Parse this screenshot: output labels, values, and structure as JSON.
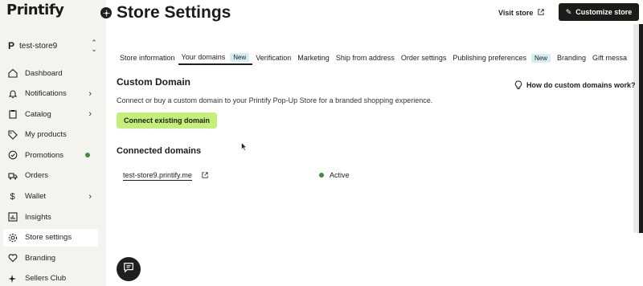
{
  "brand": {
    "logo_text": "Printify"
  },
  "store_switcher": {
    "store_name": "test-store9"
  },
  "sidebar": {
    "items": [
      {
        "label": "Dashboard",
        "icon": "home-icon"
      },
      {
        "label": "Notifications",
        "icon": "bell-icon",
        "has_arrow": true
      },
      {
        "label": "Catalog",
        "icon": "clipboard-icon",
        "has_arrow": true
      },
      {
        "label": "My products",
        "icon": "tag-icon"
      },
      {
        "label": "Promotions",
        "icon": "badge-check-icon",
        "has_dot": true
      },
      {
        "label": "Orders",
        "icon": "truck-icon"
      },
      {
        "label": "Wallet",
        "icon": "dollar-icon",
        "has_arrow": true
      },
      {
        "label": "Insights",
        "icon": "chart-icon"
      },
      {
        "label": "Store settings",
        "icon": "gear-icon",
        "active": true
      },
      {
        "label": "Branding",
        "icon": "heart-icon"
      },
      {
        "label": "Sellers Club",
        "icon": "sparkle-icon"
      }
    ]
  },
  "header": {
    "title": "Store Settings",
    "visit_store": "Visit store",
    "customize_store": "Customize store"
  },
  "tabs": [
    {
      "label": "Store information"
    },
    {
      "label": "Your domains",
      "badge": "New",
      "active": true
    },
    {
      "label": "Verification"
    },
    {
      "label": "Marketing"
    },
    {
      "label": "Ship from address"
    },
    {
      "label": "Order settings"
    },
    {
      "label": "Publishing preferences",
      "badge": "New"
    },
    {
      "label": "Branding"
    },
    {
      "label": "Gift messa"
    }
  ],
  "custom_domain": {
    "title": "Custom Domain",
    "help_link": "How do custom domains work?",
    "description": "Connect or buy a custom domain to your Printify Pop-Up Store for a branded shopping experience.",
    "connect_button": "Connect existing domain"
  },
  "connected_domains": {
    "title": "Connected domains",
    "rows": [
      {
        "domain": "test-store9.printify.me",
        "status": "Active"
      }
    ]
  },
  "colors": {
    "accent_green": "#c4f07a",
    "status_green": "#3e8e3e",
    "dark": "#1c1b19",
    "sidebar_bg": "#f3f3f0",
    "badge_bg": "#d5eef3"
  }
}
